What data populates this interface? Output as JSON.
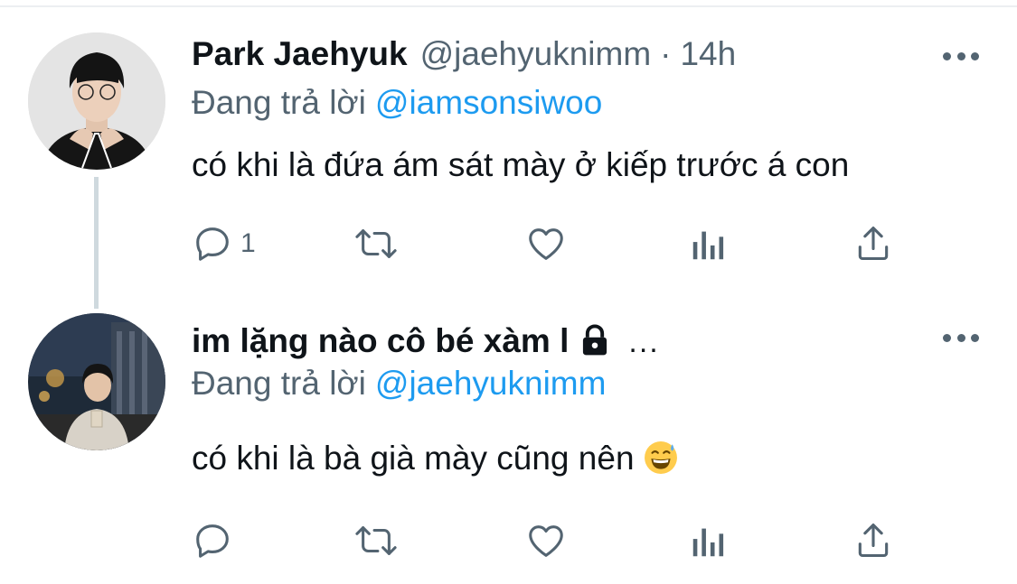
{
  "tweets": [
    {
      "name": "Park Jaehyuk",
      "handle": "@jaehyuknimm",
      "separator": "·",
      "time": "14h",
      "replying_prefix": "Đang trả lời",
      "replying_to": "@iamsonsiwoo",
      "text": "có khi là đứa ám sát mày ở kiếp trước á con",
      "reply_count": "1",
      "avatar_icon": "profile-photo"
    },
    {
      "name": "im lặng nào cô bé xàm l",
      "name_truncation": "...",
      "locked": true,
      "replying_prefix": "Đang trả lời",
      "replying_to": "@jaehyuknimm",
      "text": "có khi là bà già mày cũng nên",
      "emoji": "grinning-face-with-sweat",
      "reply_count": "",
      "avatar_icon": "profile-photo"
    }
  ],
  "icons": {
    "reply": "reply-icon",
    "retweet": "retweet-icon",
    "like": "heart-icon",
    "analytics": "analytics-icon",
    "share": "share-icon",
    "more": "more-icon",
    "lock": "lock-icon"
  },
  "colors": {
    "text": "#0f1419",
    "secondary": "#536471",
    "link": "#1d9bf0",
    "thread_line": "#cfd9de"
  }
}
